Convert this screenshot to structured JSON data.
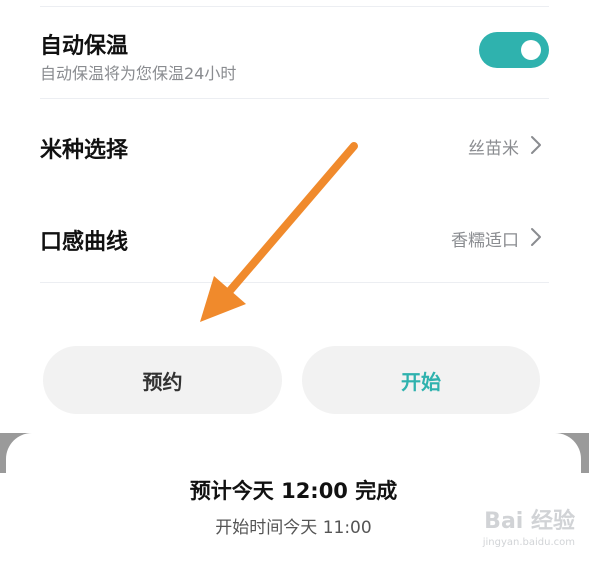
{
  "settings": {
    "keep_warm": {
      "title": "自动保温",
      "subtitle": "自动保温将为您保温24小时",
      "enabled": true
    },
    "rice_type": {
      "title": "米种选择",
      "value": "丝苗米"
    },
    "texture_curve": {
      "title": "口感曲线",
      "value": "香糯适口"
    }
  },
  "actions": {
    "schedule_label": "预约",
    "start_label": "开始"
  },
  "summary": {
    "title": "预计今天 12:00 完成",
    "subtitle": "开始时间今天 11:00"
  },
  "watermark": {
    "text": "Bai 经验",
    "url": "jingyan.baidu.com"
  },
  "colors": {
    "accent": "#2fb2ae",
    "annotation_arrow": "#f08a2c",
    "button_bg": "#f2f2f2",
    "secondary_text": "#8a8c90"
  },
  "icons": {
    "chevron": "chevron-right-icon",
    "arrow": "orange-arrow-annotation"
  }
}
